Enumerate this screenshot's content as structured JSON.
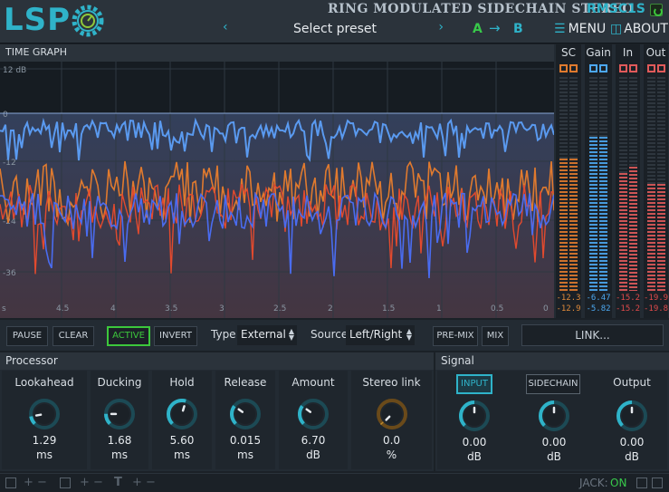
{
  "header": {
    "logo": "LSP",
    "plugin_title": "RING MODULATED SIDECHAIN STEREO",
    "plugin_code": "RMSC1S",
    "preset_label": "Select preset",
    "prev_symbol": "‹",
    "next_symbol": "›",
    "ab_a": "A",
    "ab_arrow": "→",
    "ab_b": "B",
    "menu_label": "MENU",
    "about_label": "ABOUT",
    "accent_color": "#2fb3c9"
  },
  "graph": {
    "title": "TIME GRAPH",
    "db_labels": [
      "12 dB",
      "0",
      "-12",
      "-24",
      "-36"
    ],
    "time_labels": [
      "s",
      "4.5",
      "4",
      "3.5",
      "3",
      "2.5",
      "2",
      "1.5",
      "1",
      "0.5",
      "0"
    ],
    "series_colors": {
      "sidechain": "#e07a2e",
      "input": "#e24a2e",
      "envelope": "#5a9af0",
      "output": "#4a6cf0"
    }
  },
  "meters": {
    "columns": [
      {
        "title": "SC",
        "values": [
          "-12.3",
          "-12.9"
        ],
        "value_color": "#e08a3a"
      },
      {
        "title": "Gain",
        "values": [
          "-6.47",
          "-5.82"
        ],
        "value_color": "#4ca8f0"
      },
      {
        "title": "In",
        "values": [
          "-15.2",
          "-15.2"
        ],
        "value_color": "#e04a4a"
      },
      {
        "title": "Out",
        "values": [
          "-19.9",
          "-19.8"
        ],
        "value_color": "#e04a4a"
      }
    ]
  },
  "controls": {
    "pause": "PAUSE",
    "clear": "CLEAR",
    "active": "ACTIVE",
    "invert": "INVERT",
    "type_label": "Type",
    "type_value": "External",
    "source_label": "Source",
    "source_value": "Left/Right",
    "premix": "PRE-MIX",
    "mix": "MIX",
    "link": "LINK..."
  },
  "processor": {
    "title": "Processor",
    "knobs": [
      {
        "label": "Lookahead",
        "value": "1.29",
        "unit": "ms",
        "level": 0.13
      },
      {
        "label": "Ducking",
        "value": "1.68",
        "unit": "ms",
        "level": 0.17
      },
      {
        "label": "Hold",
        "value": "5.60",
        "unit": "ms",
        "level": 0.56
      },
      {
        "label": "Release",
        "value": "0.015",
        "unit": "ms",
        "level": 0.3
      },
      {
        "label": "Amount",
        "value": "6.70",
        "unit": "dB",
        "level": 0.3
      },
      {
        "label": "Stereo link",
        "value": "0.0",
        "unit": "%",
        "level": 0.0
      }
    ]
  },
  "signal": {
    "title": "Signal",
    "input_btn": "INPUT",
    "sidechain_btn": "SIDECHAIN",
    "knobs": [
      {
        "label": "",
        "value": "0.00",
        "unit": "dB",
        "level": 0.5
      },
      {
        "label": "",
        "value": "0.00",
        "unit": "dB",
        "level": 0.5
      },
      {
        "label": "Output",
        "value": "0.00",
        "unit": "dB",
        "level": 0.5
      }
    ]
  },
  "status": {
    "jack_label": "JACK:",
    "jack_status": "ON"
  }
}
